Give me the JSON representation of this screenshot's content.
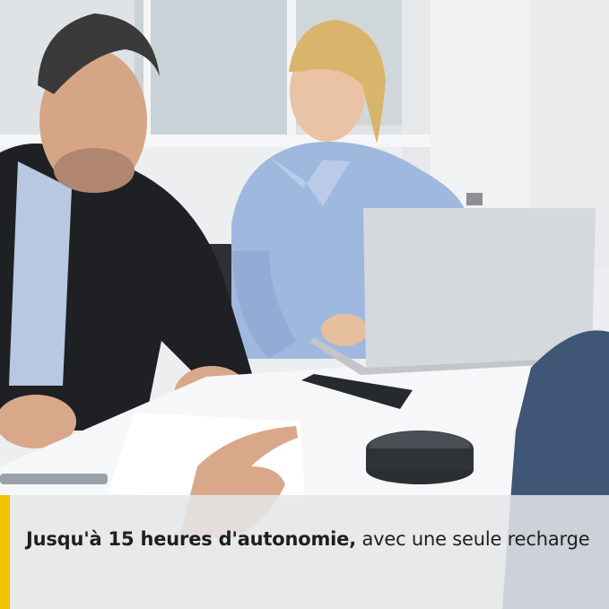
{
  "caption": {
    "bold": "Jusqu'à 15 heures d'autonomie,",
    "regular": " avec une seule recharge"
  },
  "colors": {
    "accent": "#f2c400",
    "caption_text": "#1f1f1f",
    "caption_band": "#e4e6e9"
  },
  "scene": {
    "description_icons": [
      "photo-scene",
      "speakerphone-device",
      "laptop",
      "smartphone"
    ]
  }
}
